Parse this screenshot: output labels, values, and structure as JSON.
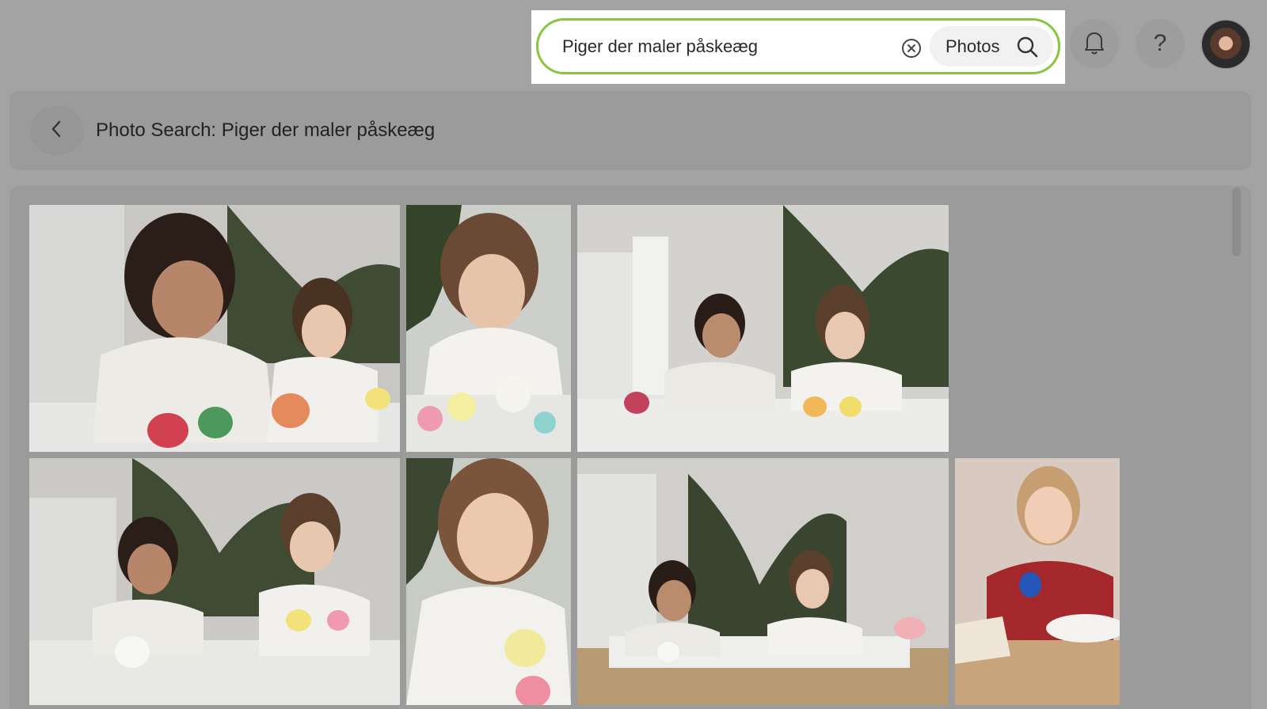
{
  "search": {
    "query": "Piger der maler påskeæg",
    "scope": "Photos"
  },
  "header": {
    "title": "Photo Search: Piger der maler påskeæg"
  },
  "colors": {
    "overlay": "#a3a3a3",
    "search_border": "#88c540",
    "panel": "#9b9b9b"
  },
  "icons": {
    "clear": "clear-circle-icon",
    "search": "magnifier-icon",
    "notifications": "bell-icon",
    "help": "question-mark-icon",
    "back": "chevron-left-icon"
  },
  "help_glyph": "?",
  "results": {
    "row1": [
      {
        "subject": "two girls painting easter eggs at kitchen table"
      },
      {
        "subject": "girl painting an egg with a brush"
      },
      {
        "subject": "two girls painting eggs in kitchen"
      }
    ],
    "row2": [
      {
        "subject": "two girls painting eggs at table with plant"
      },
      {
        "subject": "close-up girl painting egg"
      },
      {
        "subject": "two girls at table in kitchen"
      },
      {
        "subject": "girl in red dress painting blue egg"
      }
    ]
  }
}
